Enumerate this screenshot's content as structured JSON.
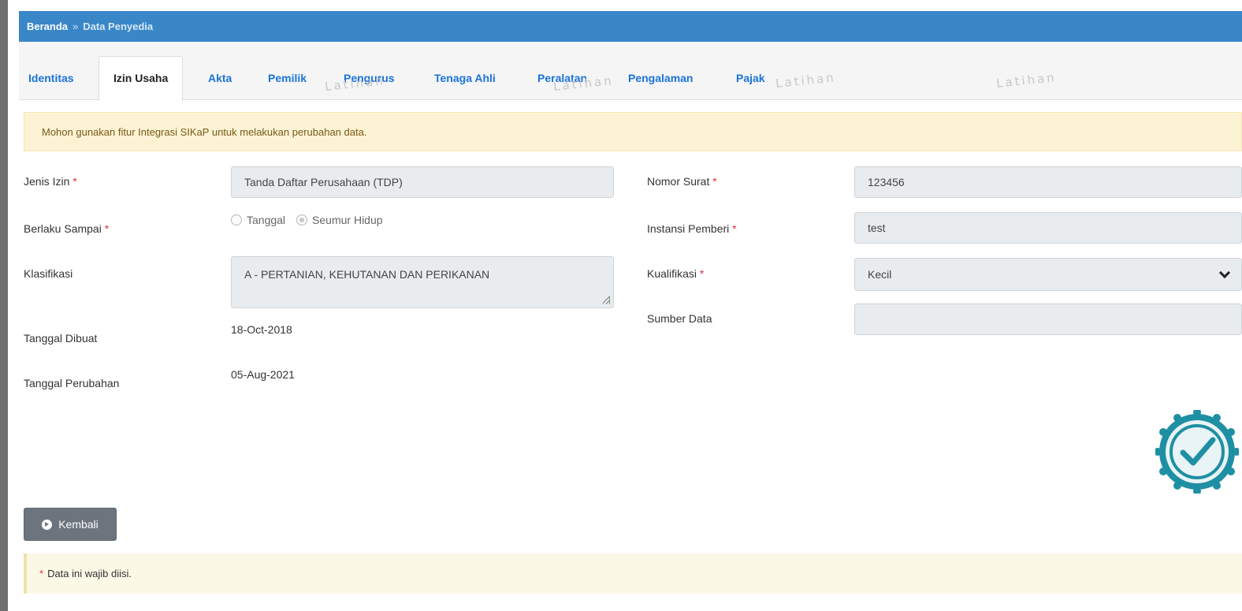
{
  "breadcrumb": {
    "home": "Beranda",
    "separator": "»",
    "current": "Data Penyedia"
  },
  "tabs": [
    {
      "label": "Identitas",
      "active": false
    },
    {
      "label": "Izin Usaha",
      "active": true
    },
    {
      "label": "Akta",
      "active": false
    },
    {
      "label": "Pemilik",
      "active": false
    },
    {
      "label": "Pengurus",
      "active": false
    },
    {
      "label": "Tenaga Ahli",
      "active": false
    },
    {
      "label": "Peralatan",
      "active": false
    },
    {
      "label": "Pengalaman",
      "active": false
    },
    {
      "label": "Pajak",
      "active": false
    }
  ],
  "watermark_text": "Latihan",
  "alert": "Mohon gunakan fitur Integrasi SIKaP untuk melakukan perubahan data.",
  "form": {
    "jenis_izin": {
      "label": "Jenis Izin",
      "value": "Tanda Daftar Perusahaan (TDP)"
    },
    "berlaku_sampai": {
      "label": "Berlaku Sampai",
      "option_tanggal": "Tanggal",
      "option_seumur": "Seumur Hidup",
      "selected": "Seumur Hidup"
    },
    "klasifikasi": {
      "label": "Klasifikasi",
      "value": "A - PERTANIAN, KEHUTANAN DAN PERIKANAN"
    },
    "tanggal_dibuat": {
      "label": "Tanggal Dibuat",
      "value": "18-Oct-2018"
    },
    "tanggal_perubahan": {
      "label": "Tanggal Perubahan",
      "value": "05-Aug-2021"
    },
    "nomor_surat": {
      "label": "Nomor Surat",
      "value": "123456"
    },
    "instansi_pemberi": {
      "label": "Instansi Pemberi",
      "value": "test"
    },
    "kualifikasi": {
      "label": "Kualifikasi",
      "value": "Kecil"
    },
    "sumber_data": {
      "label": "Sumber Data",
      "value": ""
    }
  },
  "required_marker": "*",
  "back_button": "Kembali",
  "note": "Data ini wajib diisi.",
  "colors": {
    "header": "#3a87c8",
    "tab_link": "#1a73d9",
    "required": "#d9333f",
    "badge": "#1f8fa3"
  }
}
